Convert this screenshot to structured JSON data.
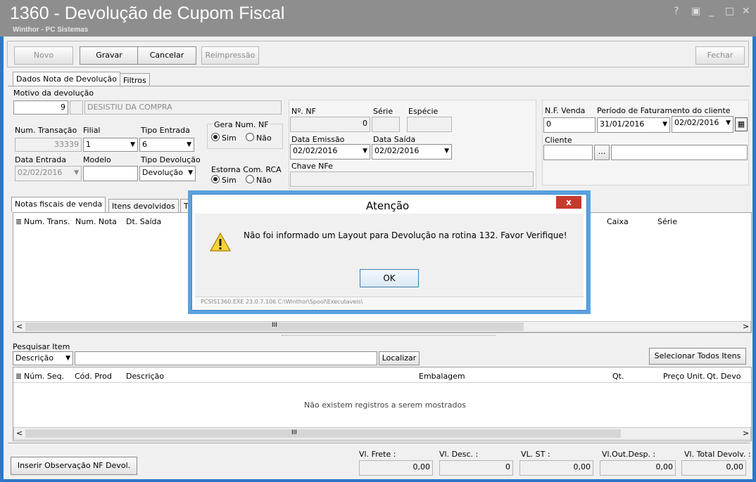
{
  "window": {
    "title": "1360 - Devolução de Cupom Fiscal",
    "subtitle": "Winthor - PC Sistemas",
    "controls": [
      "?",
      "▣",
      "_",
      "□",
      "✕"
    ]
  },
  "toolbar": {
    "novo": "Novo",
    "gravar": "Gravar",
    "cancelar": "Cancelar",
    "reimpressao": "Reimpressão",
    "fechar": "Fechar"
  },
  "top_tabs": [
    "Dados Nota de Devolução",
    "Filtros"
  ],
  "motivo": {
    "label": "Motivo da devolução",
    "code": "9",
    "description": "DESISTIU DA COMPRA"
  },
  "transacao": {
    "num_label": "Num. Transação",
    "num_value": "33339",
    "filial_label": "Filial",
    "filial_value": "1",
    "tipo_entrada_label": "Tipo Entrada",
    "tipo_entrada_value": "6",
    "data_entrada_label": "Data Entrada",
    "data_entrada_value": "02/02/2016",
    "modelo_label": "Modelo",
    "modelo_value": "",
    "tipo_devolucao_label": "Tipo Devolução",
    "tipo_devolucao_value": "Devolução"
  },
  "gera_num": {
    "label": "Gera Num. NF",
    "sim": "Sim",
    "nao": "Não"
  },
  "estorna": {
    "label": "Estorna Com. RCA",
    "sim": "Sim",
    "nao": "Não"
  },
  "nf": {
    "num_label": "Nº. NF",
    "num_value": "0",
    "serie_label": "Série",
    "especie_label": "Espécie",
    "data_emissao_label": "Data Emissão",
    "data_emissao_value": "02/02/2016",
    "data_saida_label": "Data Saída",
    "data_saida_value": "02/02/2016",
    "chave_label": "Chave NFe"
  },
  "venda": {
    "nf_label": "N.F. Venda",
    "nf_value": "0",
    "periodo_label": "Período de Faturamento do cliente",
    "periodo_de": "31/01/2016",
    "periodo_ate": "02/02/2016",
    "cliente_label": "Cliente",
    "ellipsis": "..."
  },
  "mid_tabs": [
    "Notas fiscais de venda",
    "Itens devolvidos",
    "Tr"
  ],
  "notas_grid": {
    "columns_left": [
      "Num. Trans.",
      "Num. Nota",
      "Dt. Saída"
    ],
    "columns_right": [
      "Caixa",
      "Série"
    ],
    "scroll_mid": "III"
  },
  "pesquisa": {
    "label": "Pesquisar Item",
    "field": "Descrição",
    "localizar": "Localizar",
    "selecionar": "Selecionar Todos Itens"
  },
  "itens_grid": {
    "columns": [
      "Núm. Seq.",
      "Cód. Prod",
      "Descrição",
      "Embalagem",
      "Qt.",
      "Preço Unit.",
      "Qt. Devo"
    ],
    "empty": "Não existem registros a serem mostrados",
    "scroll_mid": "III"
  },
  "footer": {
    "inserir": "Inserir Observação NF Devol.",
    "frete_label": "Vl. Frete :",
    "frete_value": "0,00",
    "desc_label": "Vl. Desc. :",
    "desc_value": "0",
    "st_label": "VL. ST :",
    "st_value": "0,00",
    "outdesp_label": "Vl.Out.Desp. :",
    "outdesp_value": "0,00",
    "total_label": "Vl. Total Devolv. :",
    "total_value": "0,00"
  },
  "dialog": {
    "title": "Atenção",
    "message": "Não foi informado um Layout para Devolução na rotina 132. Favor Verifique!",
    "ok": "OK",
    "status": "PCSIS1360.EXE 23.0.7.106 C:\\Winthor\\Spool\\Executaveis\\",
    "close": "x"
  },
  "colors": {
    "titlebar": "#8e8e8e",
    "frame": "#2b78c8",
    "dialog_border": "#3d85c6",
    "close_red": "#c63a2e"
  }
}
